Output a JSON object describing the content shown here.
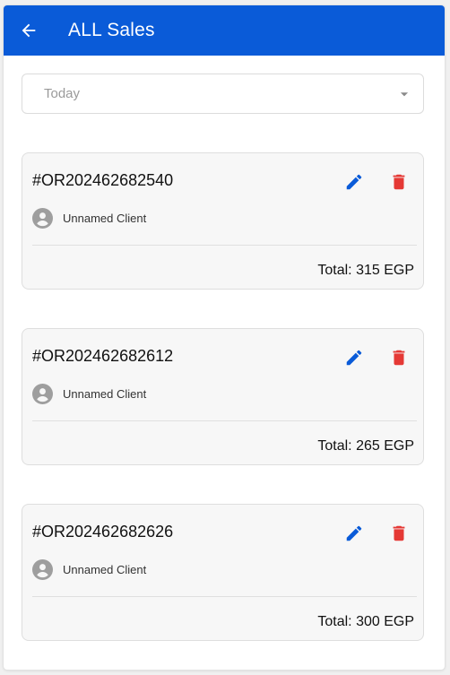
{
  "appbar": {
    "title": "ALL Sales",
    "back_icon": "arrow-left-icon",
    "background": "#0a5bd8"
  },
  "filter": {
    "selected": "Today",
    "icon": "caret-down-icon"
  },
  "orders": [
    {
      "id": "#OR202462682540",
      "client": "Unnamed Client",
      "total": "Total: 315 EGP"
    },
    {
      "id": "#OR202462682612",
      "client": "Unnamed Client",
      "total": "Total: 265 EGP"
    },
    {
      "id": "#OR202462682626",
      "client": "Unnamed Client",
      "total": "Total: 300 EGP"
    }
  ],
  "colors": {
    "edit": "#0a5bd8",
    "delete": "#e53935"
  }
}
